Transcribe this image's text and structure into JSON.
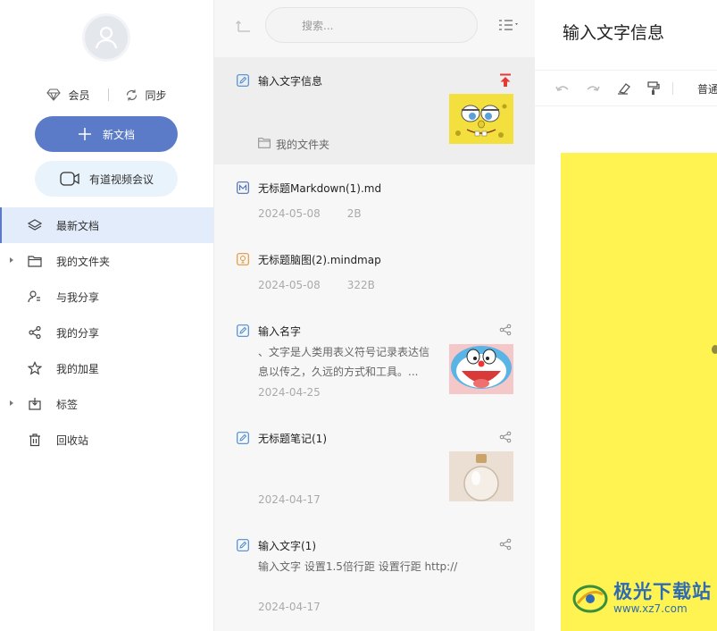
{
  "sidebar": {
    "vip_label": "会员",
    "sync_label": "同步",
    "new_doc_label": "新文档",
    "meeting_label": "有道视频会议",
    "items": [
      {
        "label": "最新文档"
      },
      {
        "label": "我的文件夹"
      },
      {
        "label": "与我分享"
      },
      {
        "label": "我的分享"
      },
      {
        "label": "我的加星"
      },
      {
        "label": "标签"
      },
      {
        "label": "回收站"
      }
    ]
  },
  "list": {
    "search_placeholder": "搜索...",
    "docs": [
      {
        "title": "输入文字信息",
        "folder": "我的文件夹"
      },
      {
        "title": "无标题Markdown(1).md",
        "date": "2024-05-08",
        "size": "2B"
      },
      {
        "title": "无标题脑图(2).mindmap",
        "date": "2024-05-08",
        "size": "322B"
      },
      {
        "title": "输入名字",
        "preview": "、文字是人类用表义符号记录表达信息以传之，久远的方式和工具。...",
        "date": "2024-04-25"
      },
      {
        "title": "无标题笔记(1)",
        "date": "2024-04-17"
      },
      {
        "title": "输入文字(1)",
        "preview": "输入文字 设置1.5倍行距 设置行距 http://",
        "date": "2024-04-17"
      }
    ]
  },
  "editor": {
    "title": "输入文字信息",
    "style_label": "普通"
  },
  "watermark": {
    "name": "极光下载站",
    "url": "www.xz7.com"
  },
  "colors": {
    "accent": "#5b7bc8",
    "pin": "#e53935",
    "canvas": "#fff352"
  }
}
